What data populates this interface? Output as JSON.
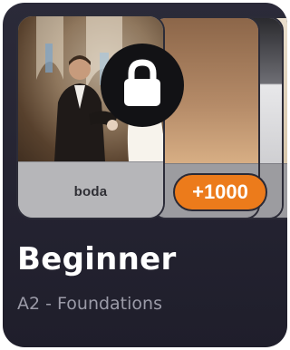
{
  "card": {
    "title": "Beginner",
    "subtitle": "A2 - Foundations",
    "badge": "+1000",
    "front_card_word": "boda",
    "locked": true
  },
  "icons": {
    "lock": "lock-icon"
  },
  "colors": {
    "card_background": "#25242f",
    "badge": "#ec7b1b",
    "lock_circle": "#121215",
    "title": "#ffffff",
    "subtitle": "#9b9ba8"
  }
}
